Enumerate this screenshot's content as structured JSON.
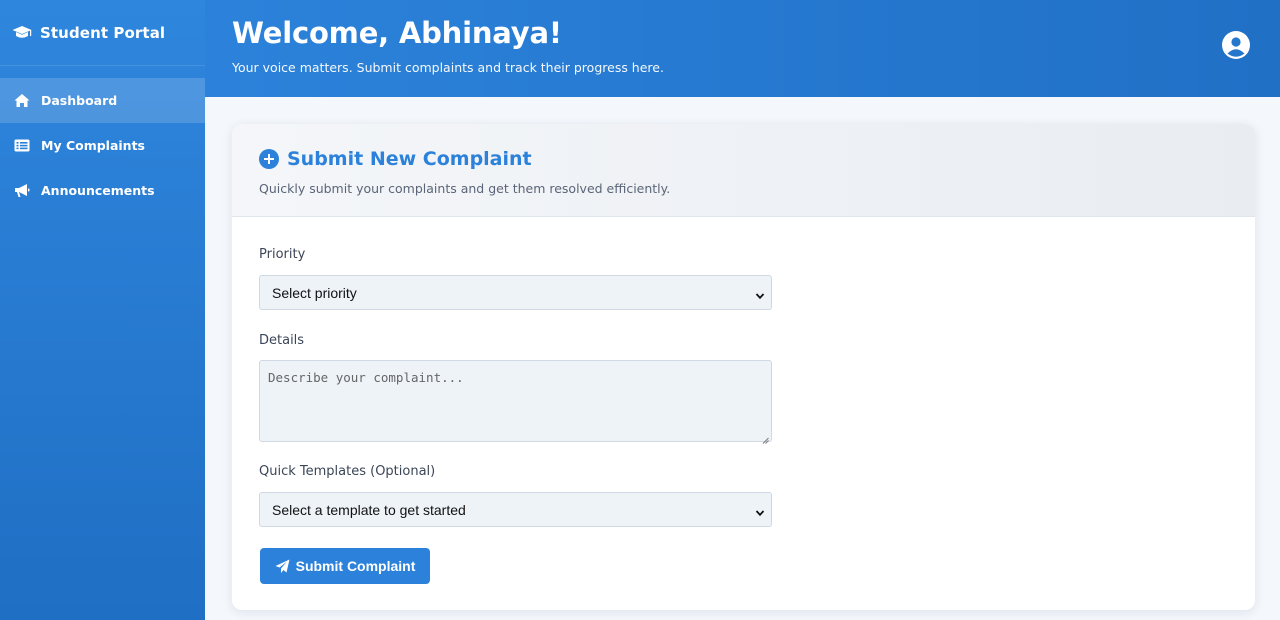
{
  "sidebar": {
    "brand": "Student Portal",
    "items": [
      {
        "label": "Dashboard",
        "icon": "home-icon",
        "active": true
      },
      {
        "label": "My Complaints",
        "icon": "list-icon",
        "active": false
      },
      {
        "label": "Announcements",
        "icon": "megaphone-icon",
        "active": false
      }
    ]
  },
  "header": {
    "title": "Welcome, Abhinaya!",
    "subtitle": "Your voice matters. Submit complaints and track their progress here."
  },
  "card": {
    "title": "Submit New Complaint",
    "subtitle": "Quickly submit your complaints and get them resolved efficiently.",
    "priority": {
      "label": "Priority",
      "value": "Select priority"
    },
    "details": {
      "label": "Details",
      "placeholder": "Describe your complaint..."
    },
    "templates": {
      "label": "Quick Templates (Optional)",
      "value": "Select a template to get started"
    },
    "submit_label": "Submit Complaint"
  },
  "colors": {
    "accent": "#2c82da",
    "sidebar_top": "#2f86dd",
    "sidebar_bottom": "#1f6fc4"
  }
}
